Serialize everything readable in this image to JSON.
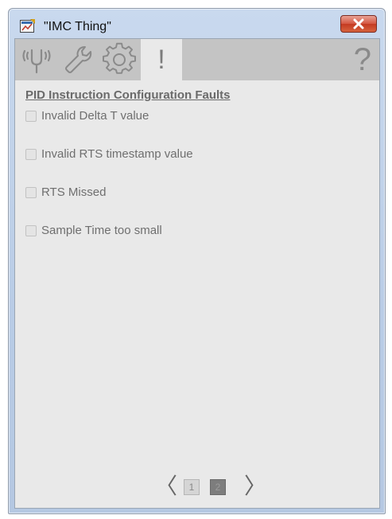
{
  "window": {
    "title": "\"IMC Thing\"",
    "app_icon": "faceplate-app-icon",
    "close_icon": "close-x-icon"
  },
  "tabs": [
    {
      "name": "operator-tab",
      "icon": "antenna-signal-icon",
      "active": false
    },
    {
      "name": "maintenance-tab",
      "icon": "wrench-icon",
      "active": false
    },
    {
      "name": "engineering-tab",
      "icon": "gear-icon",
      "active": false
    },
    {
      "name": "diagnostics-tab",
      "icon": "exclamation-icon",
      "label": "!",
      "active": true
    }
  ],
  "help": {
    "label": "?"
  },
  "section": {
    "title": "PID Instruction Configuration Faults"
  },
  "faults": [
    {
      "label": "Invalid Delta T value",
      "checked": false
    },
    {
      "label": "Invalid RTS timestamp value",
      "checked": false
    },
    {
      "label": "RTS Missed",
      "checked": false
    },
    {
      "label": "Sample Time too small",
      "checked": false
    }
  ],
  "pager": {
    "prev_label": "〈",
    "next_label": "〉",
    "pages": [
      "1",
      "2"
    ],
    "current": "2"
  },
  "colors": {
    "client_bg": "#e9e9e9",
    "tabbar_bg": "#c4c4c4",
    "close_red": "#c43a22"
  }
}
